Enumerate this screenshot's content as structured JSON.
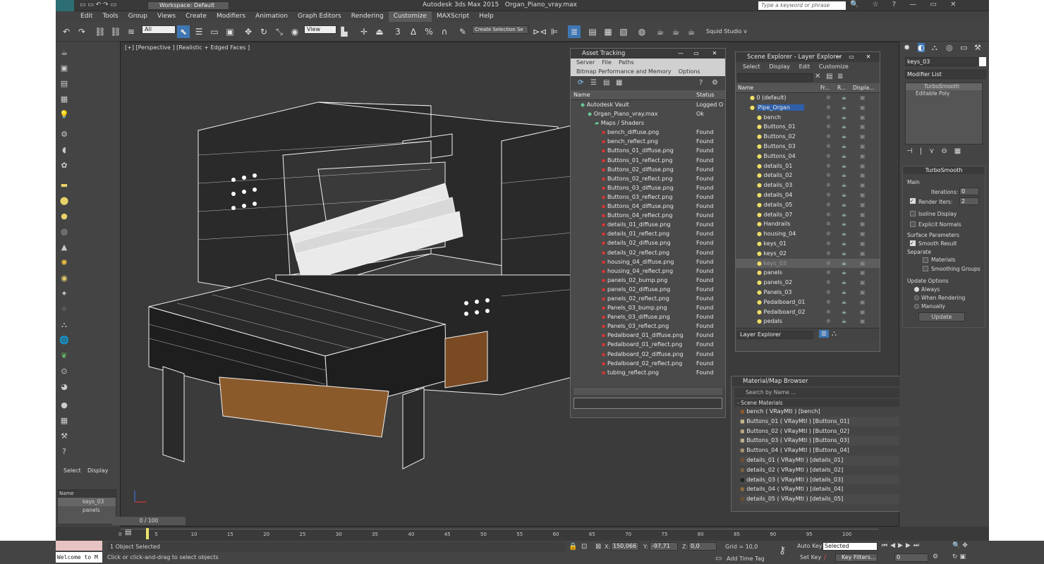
{
  "app": {
    "logo": "MAX",
    "title": "Autodesk 3ds Max  2015",
    "file": "Organ_Piano_vray.max",
    "workspace": "Workspace: Default",
    "search_placeholder": "Type a keyword or phrase"
  },
  "menu": [
    "Edit",
    "Tools",
    "Group",
    "Views",
    "Create",
    "Modifiers",
    "Animation",
    "Graph Editors",
    "Rendering",
    "Customize",
    "MAXScript",
    "Help"
  ],
  "toolbar": {
    "filter": "All",
    "view": "View",
    "selection_set": "Create Selection Se",
    "studio": "Squid Studio v"
  },
  "viewport": {
    "label": "[+] [Perspective ] [Realistic + Edged Faces ]"
  },
  "asset_tracking": {
    "title": "Asset Tracking",
    "menu1": [
      "Server",
      "File",
      "Paths"
    ],
    "menu2": [
      "Bitmap Performance and Memory",
      "Options"
    ],
    "col_name": "Name",
    "col_status": "Status",
    "rows": [
      {
        "name": "Autodesk Vault",
        "status": "Logged O",
        "indent": 1
      },
      {
        "name": "Organ_Piano_vray.max",
        "status": "Ok",
        "indent": 2
      },
      {
        "name": "Maps / Shaders",
        "status": "",
        "indent": 3
      },
      {
        "name": "bench_diffuse.png",
        "status": "Found",
        "indent": 4
      },
      {
        "name": "bench_reflect.png",
        "status": "Found",
        "indent": 4
      },
      {
        "name": "Buttons_01_diffuse.png",
        "status": "Found",
        "indent": 4
      },
      {
        "name": "Buttons_01_reflect.png",
        "status": "Found",
        "indent": 4
      },
      {
        "name": "Buttons_02_diffuse.png",
        "status": "Found",
        "indent": 4
      },
      {
        "name": "Buttons_02_reflect.png",
        "status": "Found",
        "indent": 4
      },
      {
        "name": "Buttons_03_diffuse.png",
        "status": "Found",
        "indent": 4
      },
      {
        "name": "Buttons_03_reflect.png",
        "status": "Found",
        "indent": 4
      },
      {
        "name": "Buttons_04_diffuse.png",
        "status": "Found",
        "indent": 4
      },
      {
        "name": "Buttons_04_reflect.png",
        "status": "Found",
        "indent": 4
      },
      {
        "name": "details_01_diffuse.png",
        "status": "Found",
        "indent": 4
      },
      {
        "name": "details_01_reflect.png",
        "status": "Found",
        "indent": 4
      },
      {
        "name": "details_02_diffuse.png",
        "status": "Found",
        "indent": 4
      },
      {
        "name": "details_02_reflect.png",
        "status": "Found",
        "indent": 4
      },
      {
        "name": "housing_04_diffuse.png",
        "status": "Found",
        "indent": 4
      },
      {
        "name": "housing_04_reflect.png",
        "status": "Found",
        "indent": 4
      },
      {
        "name": "panels_02_bump.png",
        "status": "Found",
        "indent": 4
      },
      {
        "name": "panels_02_diffuse.png",
        "status": "Found",
        "indent": 4
      },
      {
        "name": "panels_02_reflect.png",
        "status": "Found",
        "indent": 4
      },
      {
        "name": "Panels_03_bump.png",
        "status": "Found",
        "indent": 4
      },
      {
        "name": "Panels_03_diffuse.png",
        "status": "Found",
        "indent": 4
      },
      {
        "name": "Panels_03_reflect.png",
        "status": "Found",
        "indent": 4
      },
      {
        "name": "Pedalboard_01_diffuse.png",
        "status": "Found",
        "indent": 4
      },
      {
        "name": "Pedalboard_01_reflect.png",
        "status": "Found",
        "indent": 4
      },
      {
        "name": "Pedalboard_02_diffuse.png",
        "status": "Found",
        "indent": 4
      },
      {
        "name": "Pedalboard_02_reflect.png",
        "status": "Found",
        "indent": 4
      },
      {
        "name": "tubing_reflect.png",
        "status": "Found",
        "indent": 4
      }
    ]
  },
  "scene_explorer": {
    "title": "Scene Explorer - Layer Explorer",
    "menu": [
      "Select",
      "Display",
      "Edit",
      "Customize"
    ],
    "col_name": "Name",
    "col_fr": "Fr...",
    "col_r": "R...",
    "col_disp": "Displa...",
    "rows": [
      {
        "name": "0 (default)",
        "level": 0
      },
      {
        "name": "Pipe_Organ",
        "level": 0,
        "selected": true
      },
      {
        "name": "bench",
        "level": 1
      },
      {
        "name": "Buttons_01",
        "level": 1
      },
      {
        "name": "Buttons_02",
        "level": 1
      },
      {
        "name": "Buttons_03",
        "level": 1
      },
      {
        "name": "Buttons_04",
        "level": 1
      },
      {
        "name": "details_01",
        "level": 1
      },
      {
        "name": "details_02",
        "level": 1
      },
      {
        "name": "details_03",
        "level": 1
      },
      {
        "name": "details_04",
        "level": 1
      },
      {
        "name": "details_05",
        "level": 1
      },
      {
        "name": "details_07",
        "level": 1
      },
      {
        "name": "Handrails",
        "level": 1
      },
      {
        "name": "housing_04",
        "level": 1
      },
      {
        "name": "keys_01",
        "level": 1
      },
      {
        "name": "keys_02",
        "level": 1
      },
      {
        "name": "keys_03",
        "level": 1,
        "hl": true
      },
      {
        "name": "panels",
        "level": 1
      },
      {
        "name": "panels_02",
        "level": 1
      },
      {
        "name": "Panels_03",
        "level": 1
      },
      {
        "name": "Pedalboard_01",
        "level": 1
      },
      {
        "name": "Pedalboard_02",
        "level": 1
      },
      {
        "name": "pedals",
        "level": 1
      }
    ],
    "footer": "Layer Explorer"
  },
  "material_browser": {
    "title": "Material/Map Browser",
    "search": "Search by Name ...",
    "group": "- Scene Materials",
    "items": [
      "bench  ( VRayMtl ) [bench]",
      "Buttons_01  ( VRayMtl ) [Buttons_01]",
      "Buttons_02  ( VRayMtl ) [Buttons_02]",
      "Buttons_03  ( VRayMtl ) [Buttons_03]",
      "Buttons_04  ( VRayMtl ) [Buttons_04]",
      "details_01  ( VRayMtl ) [details_01]",
      "details_02  ( VRayMtl ) [details_02]",
      "details_03  ( VRayMtl ) [details_03]",
      "details_04  ( VRayMtl ) [details_04]",
      "details_05  ( VRayMtl ) [details_05]"
    ]
  },
  "command_panel": {
    "object_name": "keys_03",
    "modifier_list": "Modifier List",
    "stack": [
      "TurboSmooth",
      "Editable Poly"
    ],
    "rollout": "TurboSmooth",
    "main": "Main",
    "iterations_label": "Iterations:",
    "iterations": "0",
    "render_iters_label": "Render Iters:",
    "render_iters": "2",
    "isoline": "Isoline Display",
    "explicit": "Explicit Normals",
    "surface_params": "Surface Parameters",
    "smooth_result": "Smooth Result",
    "separate": "Separate",
    "materials": "Materials",
    "smoothing_groups": "Smoothing Groups",
    "update_options": "Update Options",
    "always": "Always",
    "when_rendering": "When Rendering",
    "manually": "Manually",
    "update_btn": "Update"
  },
  "left_panel": {
    "tabs": [
      "Select",
      "Display"
    ],
    "name_col": "Name",
    "items": [
      "keys_03",
      "panels"
    ]
  },
  "timeline": {
    "frame": "0 / 100",
    "ticks": [
      "0",
      "5",
      "10",
      "15",
      "20",
      "25",
      "30",
      "35",
      "40",
      "45",
      "50",
      "55",
      "60",
      "65",
      "70",
      "75",
      "80",
      "85",
      "90",
      "95",
      "100"
    ]
  },
  "status": {
    "welcome": "Welcome to M",
    "selected": "1 Object Selected",
    "prompt": "Click or click-and-drag to select objects",
    "x_label": "X:",
    "x": "150,066",
    "y_label": "Y:",
    "y": "-97,71",
    "z_label": "Z:",
    "z": "0,0",
    "grid": "Grid = 10,0",
    "autokey": "Auto Key",
    "selected_dd": "Selected",
    "setkey": "Set Key",
    "keyfilters": "Key Filters...",
    "addtime": "Add Time Tag",
    "frame_field": "0"
  }
}
